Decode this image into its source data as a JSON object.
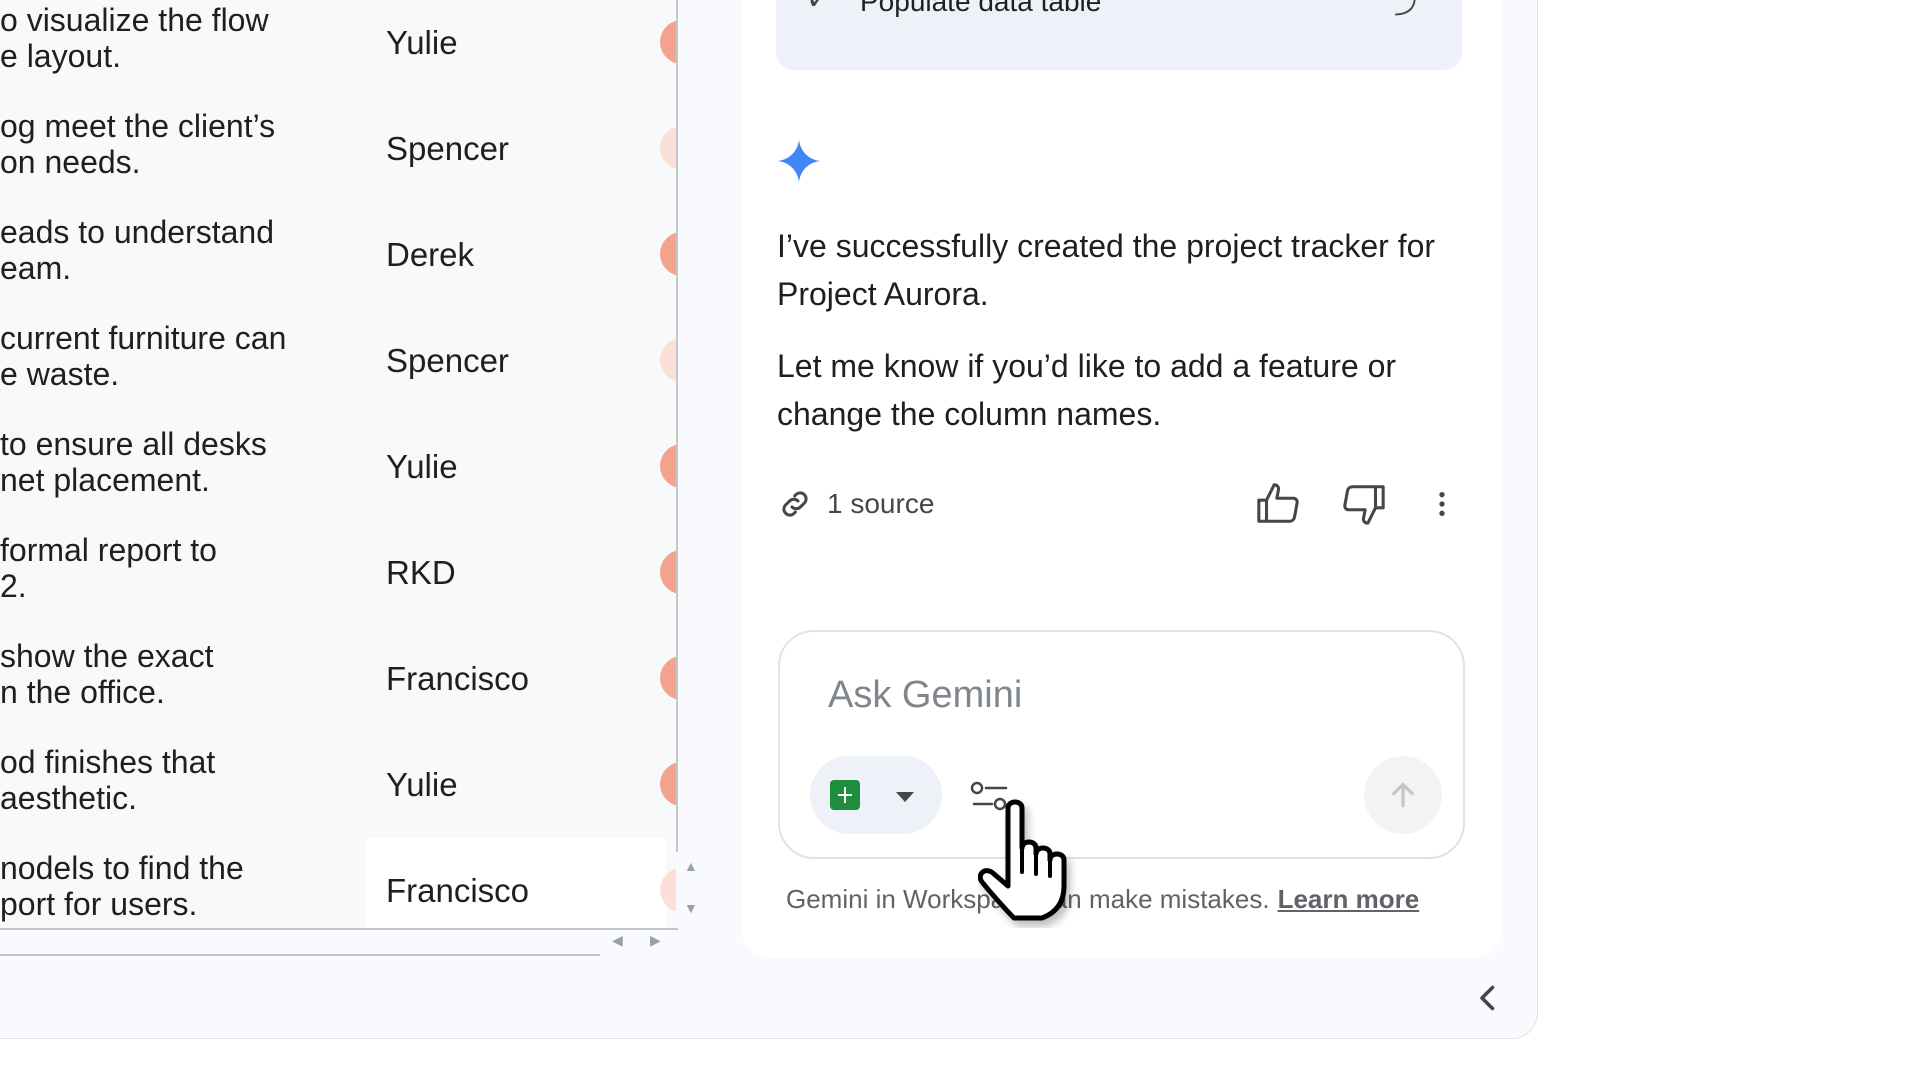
{
  "sheet": {
    "rows": [
      {
        "task": "o visualize the flow\ne layout.",
        "assignee": "Yulie",
        "status_color": "#f4a48e"
      },
      {
        "task": "og meet the client’s\non needs.",
        "assignee": "Spencer",
        "status_color": "#fbe0d7"
      },
      {
        "task": "eads to understand\neam.",
        "assignee": "Derek",
        "status_color": "#f4a48e"
      },
      {
        "task": " current furniture can\ne waste.",
        "assignee": "Spencer",
        "status_color": "#fbe0d7"
      },
      {
        "task": " to ensure all desks\nnet placement.",
        "assignee": "Yulie",
        "status_color": "#f4a48e"
      },
      {
        "task": "formal report to\n2.",
        "assignee": "RKD",
        "status_color": "#f4a48e"
      },
      {
        "task": " show the exact\nn the office.",
        "assignee": "Francisco",
        "status_color": "#f4a48e"
      },
      {
        "task": "od finishes that\n aesthetic.",
        "assignee": "Yulie",
        "status_color": "#f4a48e"
      },
      {
        "task": "nodels to find the\nport for users.",
        "assignee": "Francisco",
        "status_color": "#fbe0d7"
      }
    ]
  },
  "panel": {
    "task_card_label": "Populate data table",
    "message_paragraph_1": "I’ve successfully created the project tracker for Project Aurora.",
    "message_paragraph_2": "Let me know if you’d like to add a feature or change the column names.",
    "sources_label": "1 source",
    "input_placeholder": "Ask Gemini",
    "disclaimer_text": "Gemini in Workspace can make mistakes.",
    "learn_more": "Learn more"
  },
  "icons": {
    "task_check": "check-icon",
    "sparkle": "gemini-sparkle-icon",
    "link": "link-icon",
    "thumbs_up": "thumbs-up-icon",
    "thumbs_down": "thumbs-down-icon",
    "more": "more-vert-icon",
    "sheets": "google-sheets-icon",
    "tune": "tune-icon",
    "send": "arrow-up-icon",
    "collapse": "chevron-left-icon",
    "cursor": "hand-pointer-cursor"
  },
  "colors": {
    "accent_blue": "#4285f4",
    "sheets_green": "#1e8e3e",
    "status_strong": "#f4a48e",
    "status_light": "#fbe0d7"
  }
}
